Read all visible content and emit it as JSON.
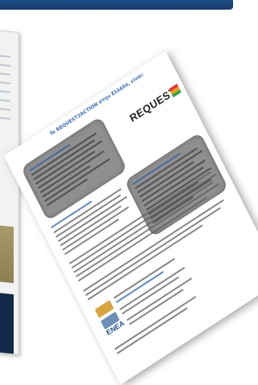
{
  "document": {
    "title": "To REQUEST2ACTION στην Ελλάδα, είναι:",
    "logo_text": "REQUEST",
    "logo_colors": [
      "#e53a2b",
      "#f39a1e",
      "#3aa24a"
    ],
    "partner_logo_text": "ENEA"
  },
  "colors": {
    "top_bar": "#1f4f86",
    "box_fill": "#8f8f8f",
    "link_blue": "#3a6bb0"
  }
}
